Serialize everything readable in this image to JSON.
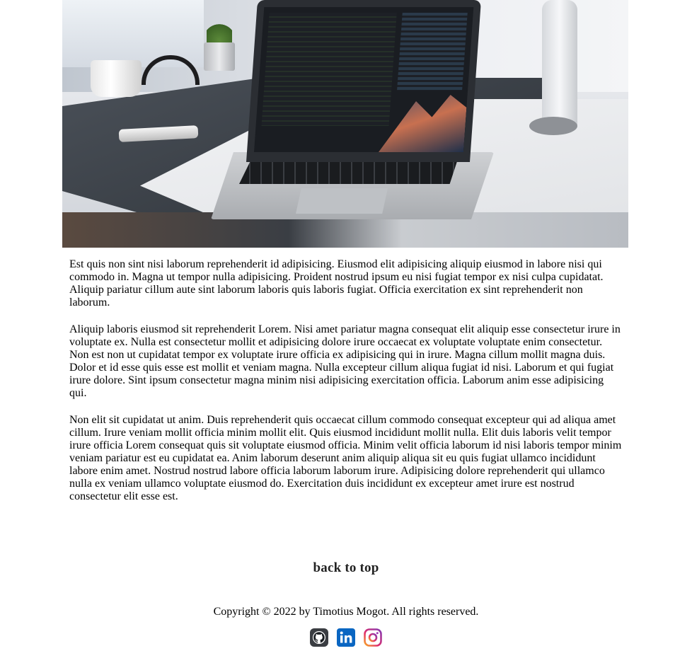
{
  "hero": {
    "alt": "Laptop on a desk showing code"
  },
  "article": {
    "paragraphs": [
      "Est quis non sint nisi laborum reprehenderit id adipisicing. Eiusmod elit adipisicing aliquip eiusmod in labore nisi qui commodo in. Magna ut tempor nulla adipisicing. Proident nostrud ipsum eu nisi fugiat tempor ex nisi culpa cupidatat. Aliquip pariatur cillum aute sint laborum laboris quis laboris fugiat. Officia exercitation ex sint reprehenderit non laborum.",
      "Aliquip laboris eiusmod sit reprehenderit Lorem. Nisi amet pariatur magna consequat elit aliquip esse consectetur irure in voluptate ex. Nulla est consectetur mollit et adipisicing dolore irure occaecat ex voluptate voluptate enim consectetur. Non est non ut cupidatat tempor ex voluptate irure officia ex adipisicing qui in irure. Magna cillum mollit magna duis. Dolor et id esse quis esse est mollit et veniam magna. Nulla excepteur cillum aliqua fugiat id nisi. Laborum et qui fugiat irure dolore. Sint ipsum consectetur magna minim nisi adipisicing exercitation officia. Laborum anim esse adipisicing qui.",
      "Non elit sit cupidatat ut anim. Duis reprehenderit quis occaecat cillum commodo consequat excepteur qui ad aliqua amet cillum. Irure veniam mollit officia minim mollit elit. Quis eiusmod incididunt mollit nulla. Elit duis laboris velit tempor irure officia Lorem consequat quis sit voluptate eiusmod officia. Minim velit officia laborum id nisi laboris tempor minim veniam pariatur est eu cupidatat ea. Anim laborum deserunt anim aliquip aliqua sit eu quis fugiat ullamco incididunt labore enim amet. Nostrud nostrud labore officia laborum laborum irure. Adipisicing dolore reprehenderit qui ullamco nulla ex veniam ullamco voluptate eiusmod do. Exercitation duis incididunt ex excepteur amet irure est nostrud consectetur elit esse est."
    ]
  },
  "footer": {
    "back_to_top": "back to top",
    "copyright": "Copyright © 2022 by Timotius Mogot. All rights reserved.",
    "socials": [
      {
        "icon": "github-icon",
        "color": "#1b1f23"
      },
      {
        "icon": "linkedin-icon",
        "color": "#0a66c2"
      },
      {
        "icon": "instagram-icon",
        "color": "#c13584"
      }
    ]
  }
}
